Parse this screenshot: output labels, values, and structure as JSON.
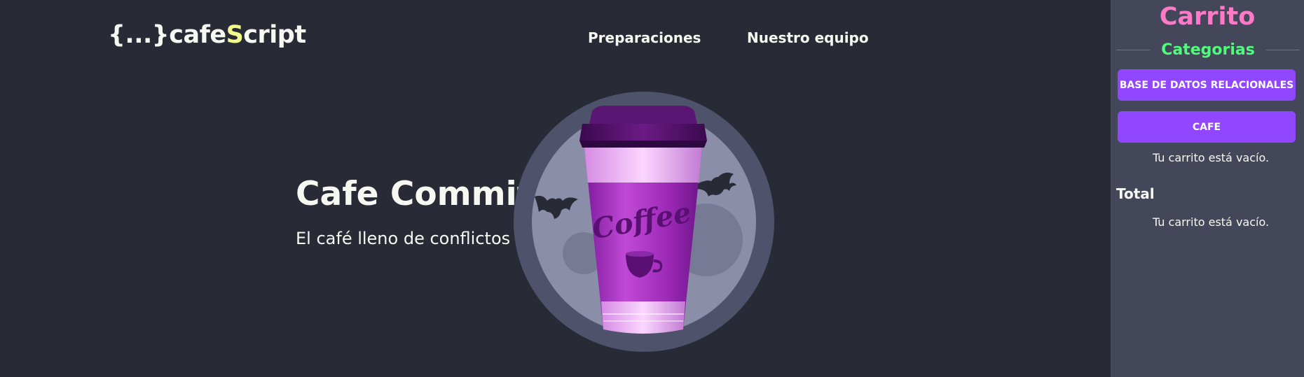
{
  "header": {
    "logo_prefix": "{...}",
    "logo_cafe": "cafe",
    "logo_s": "S",
    "logo_cript": "cript",
    "nav": [
      "Preparaciones",
      "Nuestro equipo"
    ]
  },
  "hero": {
    "title": "Cafe Commit",
    "subtitle": "El café lleno de conflictos",
    "cup_label": "Coffee"
  },
  "cart": {
    "title": "Carrito",
    "categories_title": "Categorias",
    "categories": [
      "BASE DE DATOS RELACIONALES",
      "CAFE"
    ],
    "empty_message": "Tu carrito está vacío.",
    "total_label": "Total",
    "total_message": "Tu carrito está vacío."
  },
  "colors": {
    "background": "#282a36",
    "sidebar": "#44475a",
    "cart_title": "#ff79c6",
    "categories_title": "#50fa7b",
    "button": "#9147ff",
    "logo_accent": "#f1fa8c"
  }
}
